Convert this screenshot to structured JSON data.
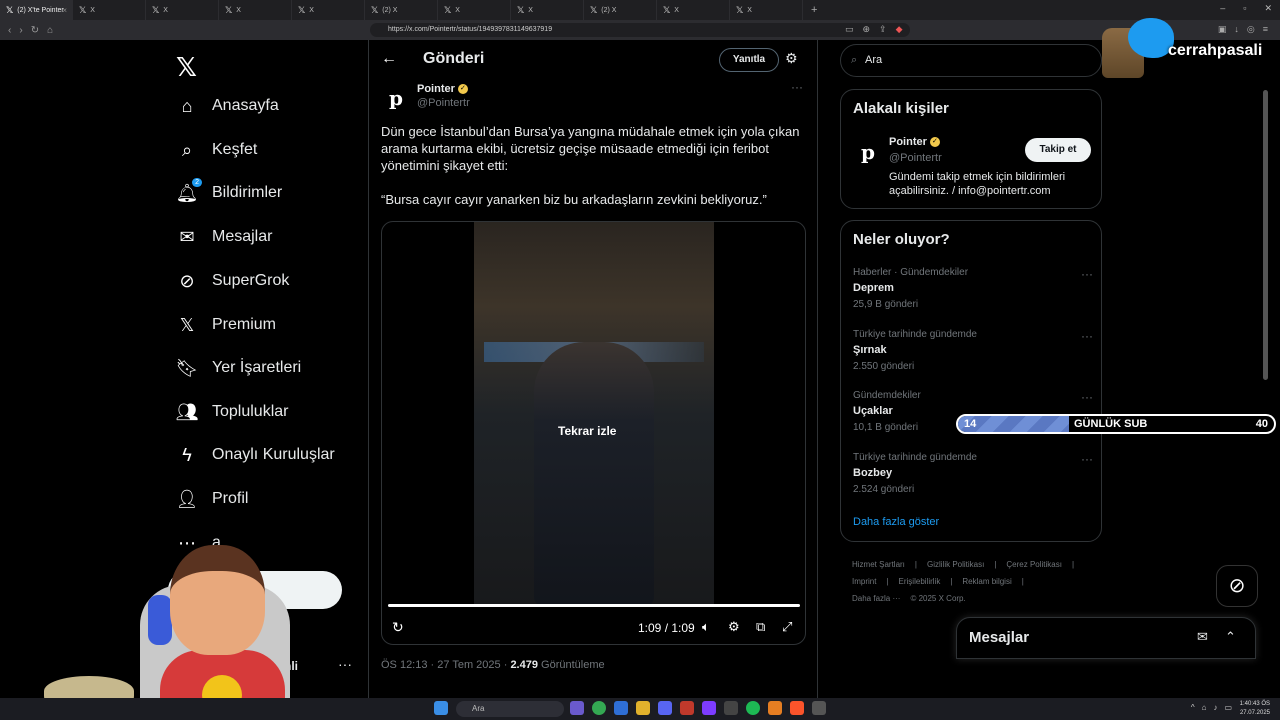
{
  "browser": {
    "tabs": [
      {
        "label": "(2) X'te Pointer"
      },
      {
        "label": "X"
      },
      {
        "label": "X"
      },
      {
        "label": "X"
      },
      {
        "label": "X"
      },
      {
        "label": "(2) X"
      },
      {
        "label": "X"
      },
      {
        "label": "X"
      },
      {
        "label": "(2) X"
      },
      {
        "label": "X"
      },
      {
        "label": "X"
      }
    ],
    "url": "https://x.com/Pointertr/status/1949397831149637919"
  },
  "nav": {
    "items": [
      {
        "label": "Anasayfa",
        "icon": "home-icon"
      },
      {
        "label": "Keşfet",
        "icon": "search-icon"
      },
      {
        "label": "Bildirimler",
        "icon": "bell-icon",
        "badge": "2"
      },
      {
        "label": "Mesajlar",
        "icon": "mail-icon"
      },
      {
        "label": "SuperGrok",
        "icon": "grok-icon"
      },
      {
        "label": "Premium",
        "icon": "x-icon"
      },
      {
        "label": "Yer İşaretleri",
        "icon": "bookmark-icon"
      },
      {
        "label": "Topluluklar",
        "icon": "people-icon"
      },
      {
        "label": "Onaylı Kuruluşlar",
        "icon": "lightning-icon"
      },
      {
        "label": "Profil",
        "icon": "person-icon"
      },
      {
        "label": "a",
        "icon": "more-circle-icon"
      }
    ],
    "post_button_partial": "ınla",
    "profile_name_partial": "nli"
  },
  "post": {
    "header_title": "Gönderi",
    "reply_button": "Yanıtla",
    "author_name": "Pointer",
    "author_handle": "@Pointertr",
    "text_paragraph_1": "Dün gece İstanbul’dan Bursa’ya yangına müdahale etmek için yola çıkan arama kurtarma ekibi, ücretsiz geçişe müsaade etmediği için feribot yönetimini şikayet etti:",
    "text_paragraph_2": "“Bursa cayır cayır yanarken biz bu arkadaşların zevkini bekliyoruz.”",
    "video_replay_label": "Tekrar izle",
    "video_time": "1:09 / 1:09",
    "video_progress": 1.0,
    "timestamp": "ÖS 12:13 · 27 Tem 2025 · ",
    "views_count": "2.479",
    "views_label": " Görüntüleme"
  },
  "sidebar": {
    "search_placeholder": "Ara",
    "related_title": "Alakalı kişiler",
    "related_name": "Pointer",
    "related_handle": "@Pointertr",
    "related_bio": "Gündemi takip etmek için bildirimleri açabilirsiniz. / info@pointertr.com",
    "follow_button": "Takip et",
    "trends_title": "Neler oluyor?",
    "trends": [
      {
        "category": "Haberler · Gündemdekiler",
        "title": "Deprem",
        "count": "25,9 B gönderi"
      },
      {
        "category": "Türkiye tarihinde gündemde",
        "title": "Şırnak",
        "count": "2.550 gönderi"
      },
      {
        "category": "Gündemdekiler",
        "title": "Uçaklar",
        "count": "10,1 B gönderi"
      },
      {
        "category": "Türkiye tarihinde gündemde",
        "title": "Bozbey",
        "count": "2.524 gönderi"
      }
    ],
    "show_more": "Daha fazla göster",
    "footer_row1": [
      "Hizmet Şartları",
      "|",
      "Gizlilik Politikası",
      "|",
      "Çerez Politikası",
      "|"
    ],
    "footer_row2": [
      "Imprint",
      "|",
      "Erişilebilirlik",
      "|",
      "Reklam bilgisi",
      "|"
    ],
    "footer_row3": [
      "Daha fazla ···",
      "© 2025 X Corp."
    ]
  },
  "messages_dock": {
    "title": "Mesajlar"
  },
  "overlay": {
    "brand": "cerrahpasali",
    "sub_current": "14",
    "sub_label": "GÜNLÜK SUB",
    "sub_goal": "40",
    "sub_progress": 0.35
  },
  "taskbar": {
    "search": "Ara",
    "time": "1:40:43 ÖS",
    "date": "27.07.2025"
  },
  "colors": {
    "accent": "#1d9bf0",
    "background": "#000000",
    "verified_gold": "#f2c94c"
  }
}
